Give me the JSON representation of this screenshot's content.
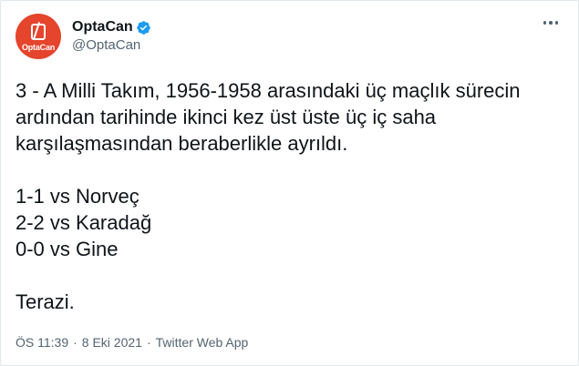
{
  "author": {
    "display_name": "OptaCan",
    "handle": "@OptaCan",
    "avatar_text": "OptaCan",
    "verified": true,
    "brand_color": "#e4452c",
    "verified_color": "#1d9bf0"
  },
  "tweet": {
    "paragraph_1": "3 - A Milli Takım, 1956-1958 arasındaki üç maçlık sürecin ardından tarihinde ikinci kez üst üste üç iç saha karşılaşmasından beraberlikle ayrıldı.",
    "results": [
      "1-1 vs Norveç",
      "2-2 vs Karadağ",
      "0-0 vs Gine"
    ],
    "closing": "Terazi."
  },
  "meta": {
    "time": "ÖS 11:39",
    "date": "8 Eki 2021",
    "separator": "·",
    "source": "Twitter Web App"
  },
  "icons": {
    "more": "more-horizontal-icon",
    "verified": "verified-badge-icon"
  }
}
